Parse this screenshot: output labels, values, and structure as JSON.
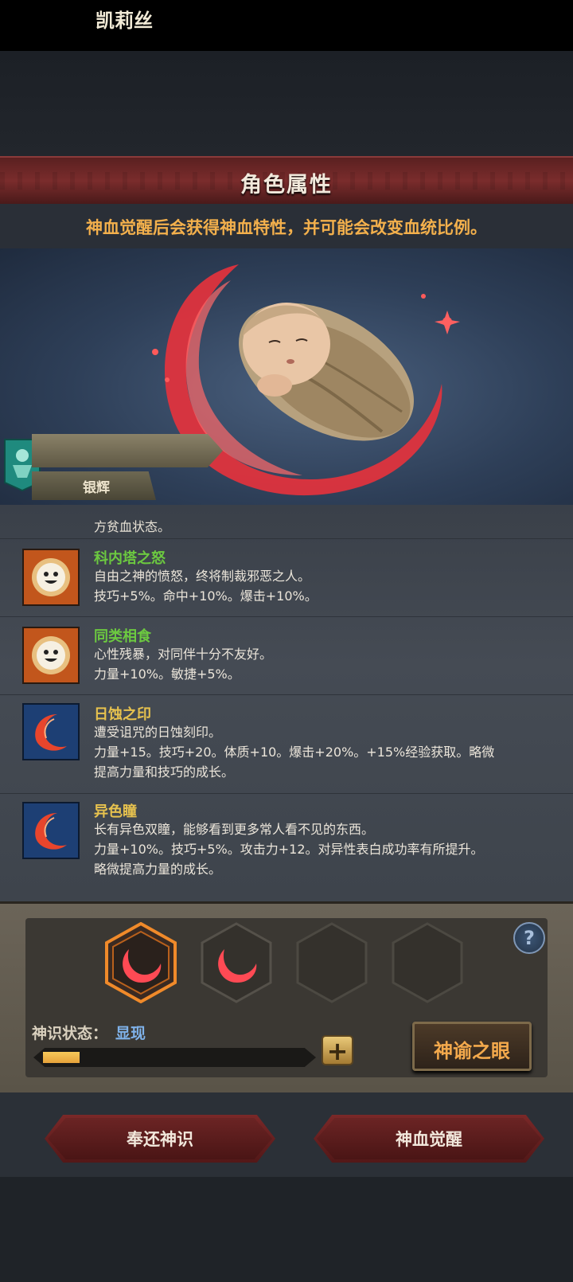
{
  "header": {
    "title": "角色属性"
  },
  "subtitle": "神血觉醒后会获得神血特性，并可能会改变血统比例。",
  "character": {
    "name": "凯莉丝",
    "title": "银辉"
  },
  "traits_top_fragment": "方贫血状态。",
  "traits": [
    {
      "name": "科内塔之怒",
      "color": "#6cc940",
      "icon": "smiley-icon",
      "desc": [
        "自由之神的愤怒，终将制裁邪恶之人。",
        "技巧+5%。命中+10%。爆击+10%。"
      ]
    },
    {
      "name": "同类相食",
      "color": "#6cc940",
      "icon": "smiley-icon",
      "desc": [
        "心性残暴，对同伴十分不友好。",
        "力量+10%。敏捷+5%。"
      ]
    },
    {
      "name": "日蚀之印",
      "color": "#e7c24e",
      "icon": "crescent-icon",
      "desc": [
        "遭受诅咒的日蚀刻印。",
        "力量+15。技巧+20。体质+10。爆击+20%。+15%经验获取。略微",
        "提高力量和技巧的成长。"
      ]
    },
    {
      "name": "异色瞳",
      "color": "#e7c24e",
      "icon": "crescent-icon",
      "desc": [
        "长有异色双瞳，能够看到更多常人看不见的东西。",
        "力量+10%。技巧+5%。攻击力+12。对异性表白成功率有所提升。",
        "略微提高力量的成长。"
      ]
    }
  ],
  "divine": {
    "state_label": "神识状态：",
    "state_value": "显现",
    "progress_fraction": 0.14,
    "plus_symbol": "+",
    "help_symbol": "?",
    "eye_button": "神谕之眼"
  },
  "actions": {
    "return_label": "奉还神识",
    "awaken_label": "神血觉醒"
  },
  "colors": {
    "accent_red": "#7a2828",
    "accent_orange": "#f3a94c",
    "state_blue": "#7fb2ea"
  }
}
